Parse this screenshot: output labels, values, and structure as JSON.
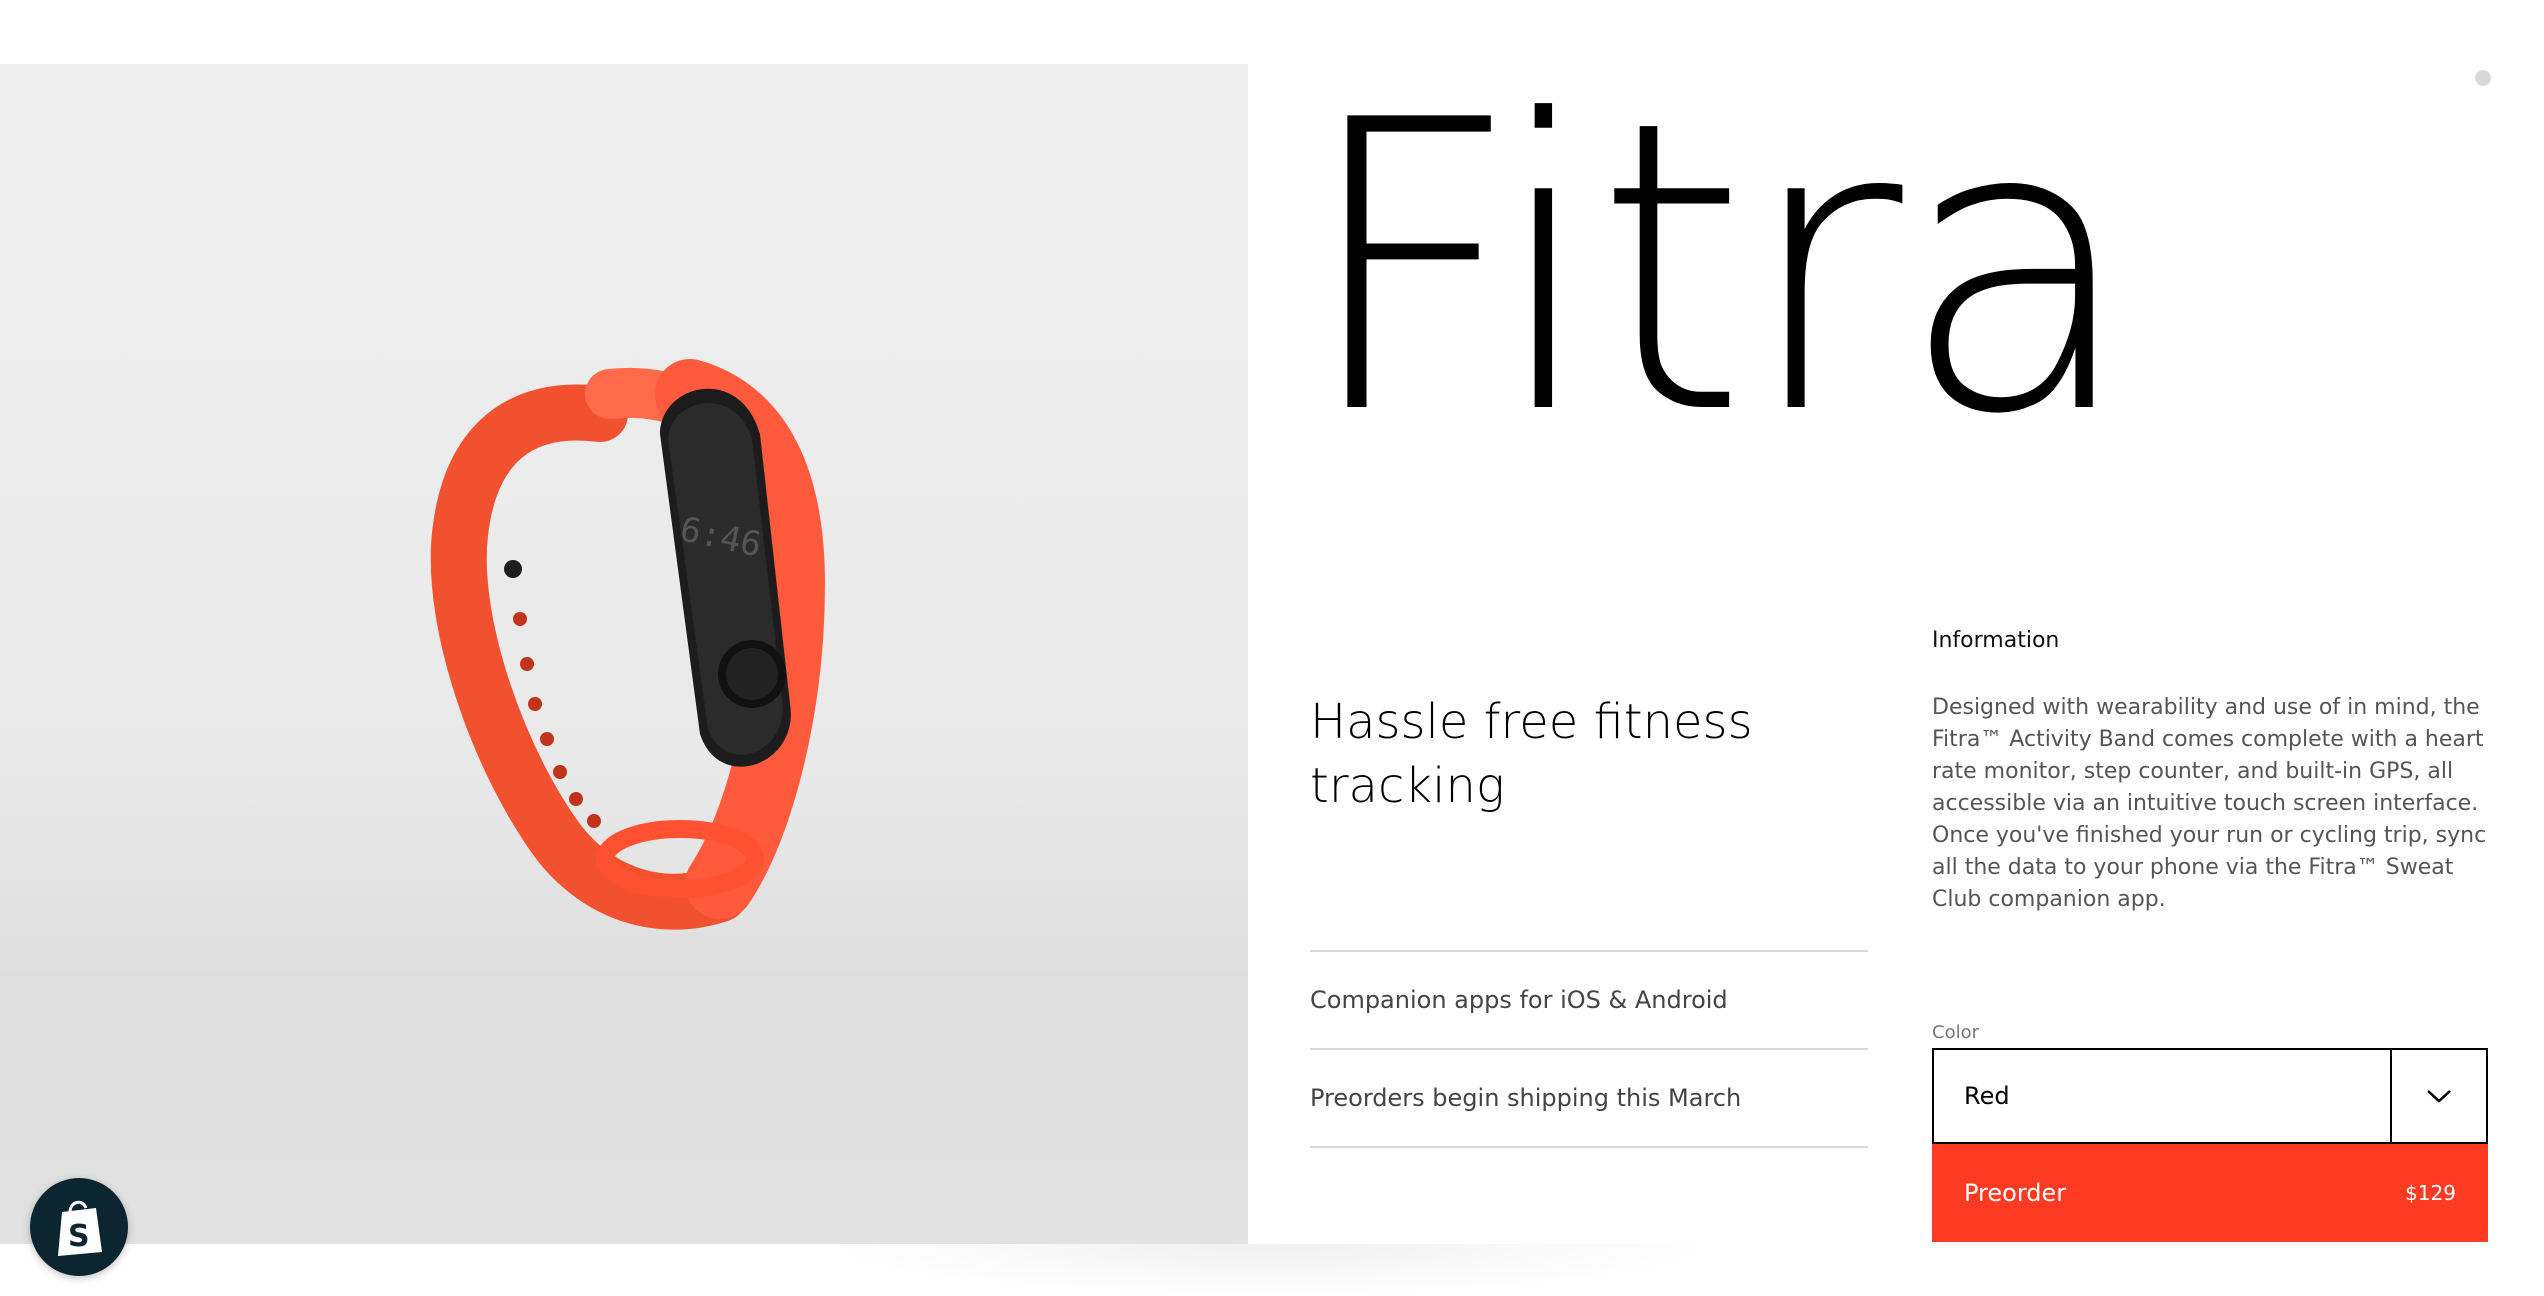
{
  "product": {
    "title": "Fitra",
    "tagline": "Hassle free fitness tracking",
    "image_icon": "fitness-band-image",
    "display_time": "6:46"
  },
  "features": [
    "Companion apps for iOS & Android",
    "Preorders begin shipping this March"
  ],
  "information": {
    "heading": "Information",
    "body": "Designed with wearability and use of in mind, the Fitra™ Activity Band comes complete with a heart rate monitor, step counter, and built-in GPS, all accessible via an intuitive touch screen interface. Once you've finished your run or cycling trip, sync all the data to your phone via the Fitra™ Sweat Club companion app."
  },
  "color_selector": {
    "label": "Color",
    "selected": "Red",
    "icon": "chevron-down-icon"
  },
  "preorder_button": {
    "label": "Preorder",
    "price": "$129"
  },
  "badge": {
    "icon": "shopify-bag-icon"
  },
  "colors": {
    "accent": "#ff3a22",
    "band": "#ff5a3c",
    "badge_bg": "#0b2630"
  }
}
